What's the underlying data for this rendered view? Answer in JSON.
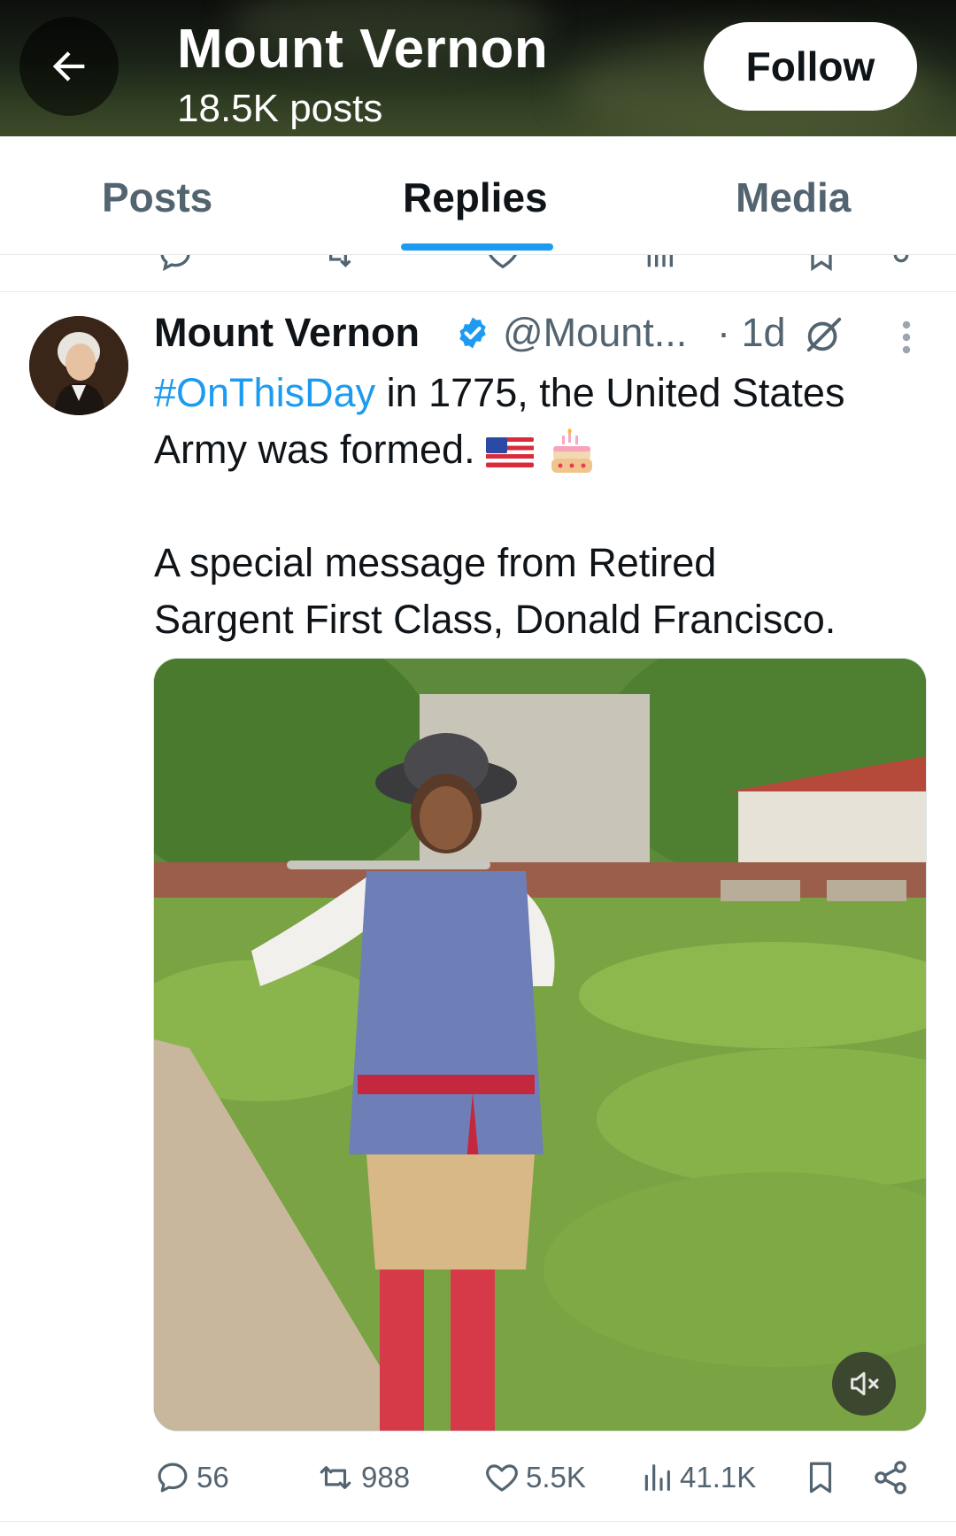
{
  "header": {
    "back_icon": "arrow-left-icon",
    "title": "Mount Vernon",
    "subtitle": "18.5K posts",
    "follow_label": "Follow"
  },
  "tabs": [
    {
      "label": "Posts",
      "active": false
    },
    {
      "label": "Replies",
      "active": true
    },
    {
      "label": "Media",
      "active": false
    }
  ],
  "tweet": {
    "author_name": "Mount Vernon",
    "verified": true,
    "handle": "@Mount...",
    "time": "· 1d",
    "hashtag": "#OnThisDay",
    "text_line1_rest": " in 1775, the United States",
    "text_line2": "Army was formed.",
    "text_line3": "A special message from Retired",
    "text_line4": "Sargent First Class, Donald Francisco.",
    "emojis": [
      "flag-us-emoji",
      "birthday-cake-emoji"
    ],
    "media": {
      "type": "video",
      "muted": true
    }
  },
  "actions": {
    "replies": "56",
    "reposts": "988",
    "likes": "5.5K",
    "views": "41.1K"
  },
  "colors": {
    "accent": "#1d9bf0",
    "text_primary": "#0f1419",
    "text_secondary": "#536471"
  }
}
